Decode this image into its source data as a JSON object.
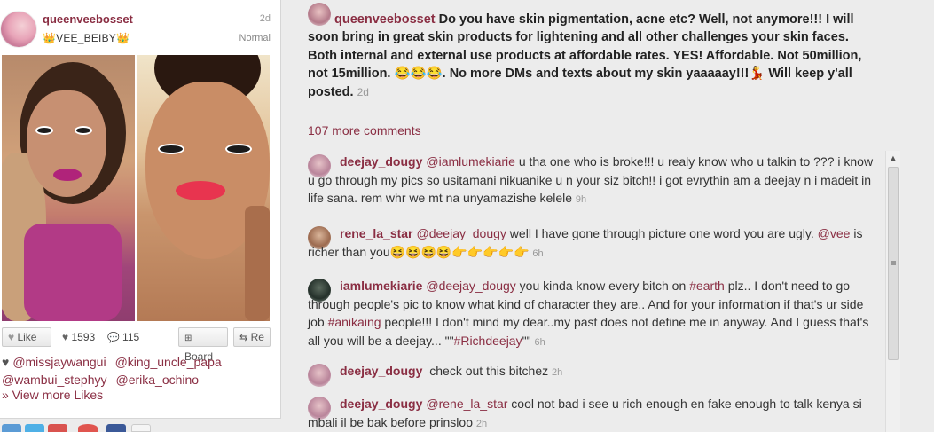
{
  "post": {
    "username": "queenveebosset",
    "bio": "👑VEE_BEIBY👑",
    "time": "2d",
    "filter": "Normal",
    "like_label": "Like",
    "like_count": "1593",
    "comment_count": "115",
    "board_label": "Board",
    "repost_label": "Re",
    "likers": [
      "@missjaywangui",
      "@king_uncle_papa",
      "@wambui_stephyy",
      "@erika_ochino"
    ],
    "view_more_likes": "» View more Likes"
  },
  "caption": {
    "username": "queenveebosset",
    "text": "Do you have skin pigmentation, acne etc? Well, not anymore!!! I will soon bring in great skin products for lightening and all other challenges your skin faces. Both internal and external use products at affordable rates. YES! Affordable. Not 50million, not 15million. 😂😂😂. No more DMs and texts about my skin yaaaaay!!!💃 Will keep y'all posted.",
    "time": "2d"
  },
  "more_comments": "107 more comments",
  "comments": [
    {
      "username": "deejay_dougy",
      "mention": "@iamlumekiarie",
      "text": " u tha one who is broke!!! u realy know who u talkin to ??? i know u go through my pics so usitamani nikuanike u n your siz bitch!! i got evrythin am a deejay n i madeit in life sana. rem whr we mt na unyamazishe kelele",
      "time": "9h"
    },
    {
      "username": "rene_la_star",
      "mention": "@deejay_dougy",
      "text": " well I have gone through picture one word you are ugly. ",
      "mention2": "@vee",
      "text2": " is richer than you😆😆😆😆👉👉👉👉👉",
      "time": "6h"
    },
    {
      "username": "iamlumekiarie",
      "mention": "@deejay_dougy",
      "text": " you kinda know every bitch on ",
      "tag1": "#earth",
      "text2": " plz.. I don't need to go through people's pic to know what kind of character they are.. And for your information if that's ur side job ",
      "tag2": "#anikaing",
      "text3": " people!!! I don't mind my dear..my past does not define me in anyway. And I guess that's all you will be a deejay... \"\"",
      "tag3": "#Richdeejay",
      "text4": "\"\"",
      "time": "6h"
    },
    {
      "username": "deejay_dougy",
      "text": "check out this bitchez",
      "time": "2h"
    },
    {
      "username": "deejay_dougy",
      "mention": "@rene_la_star",
      "text": " cool not bad i see u rich enough en fake enough to talk kenya si mbali il be bak before prinsloo",
      "time": "2h"
    }
  ],
  "colors": {
    "accent": "#8a2e43",
    "background": "#ececec",
    "muted": "#999999"
  },
  "icons": [
    "heart-icon",
    "comment-icon",
    "plus-icon",
    "repost-icon",
    "scroll-up-icon"
  ]
}
